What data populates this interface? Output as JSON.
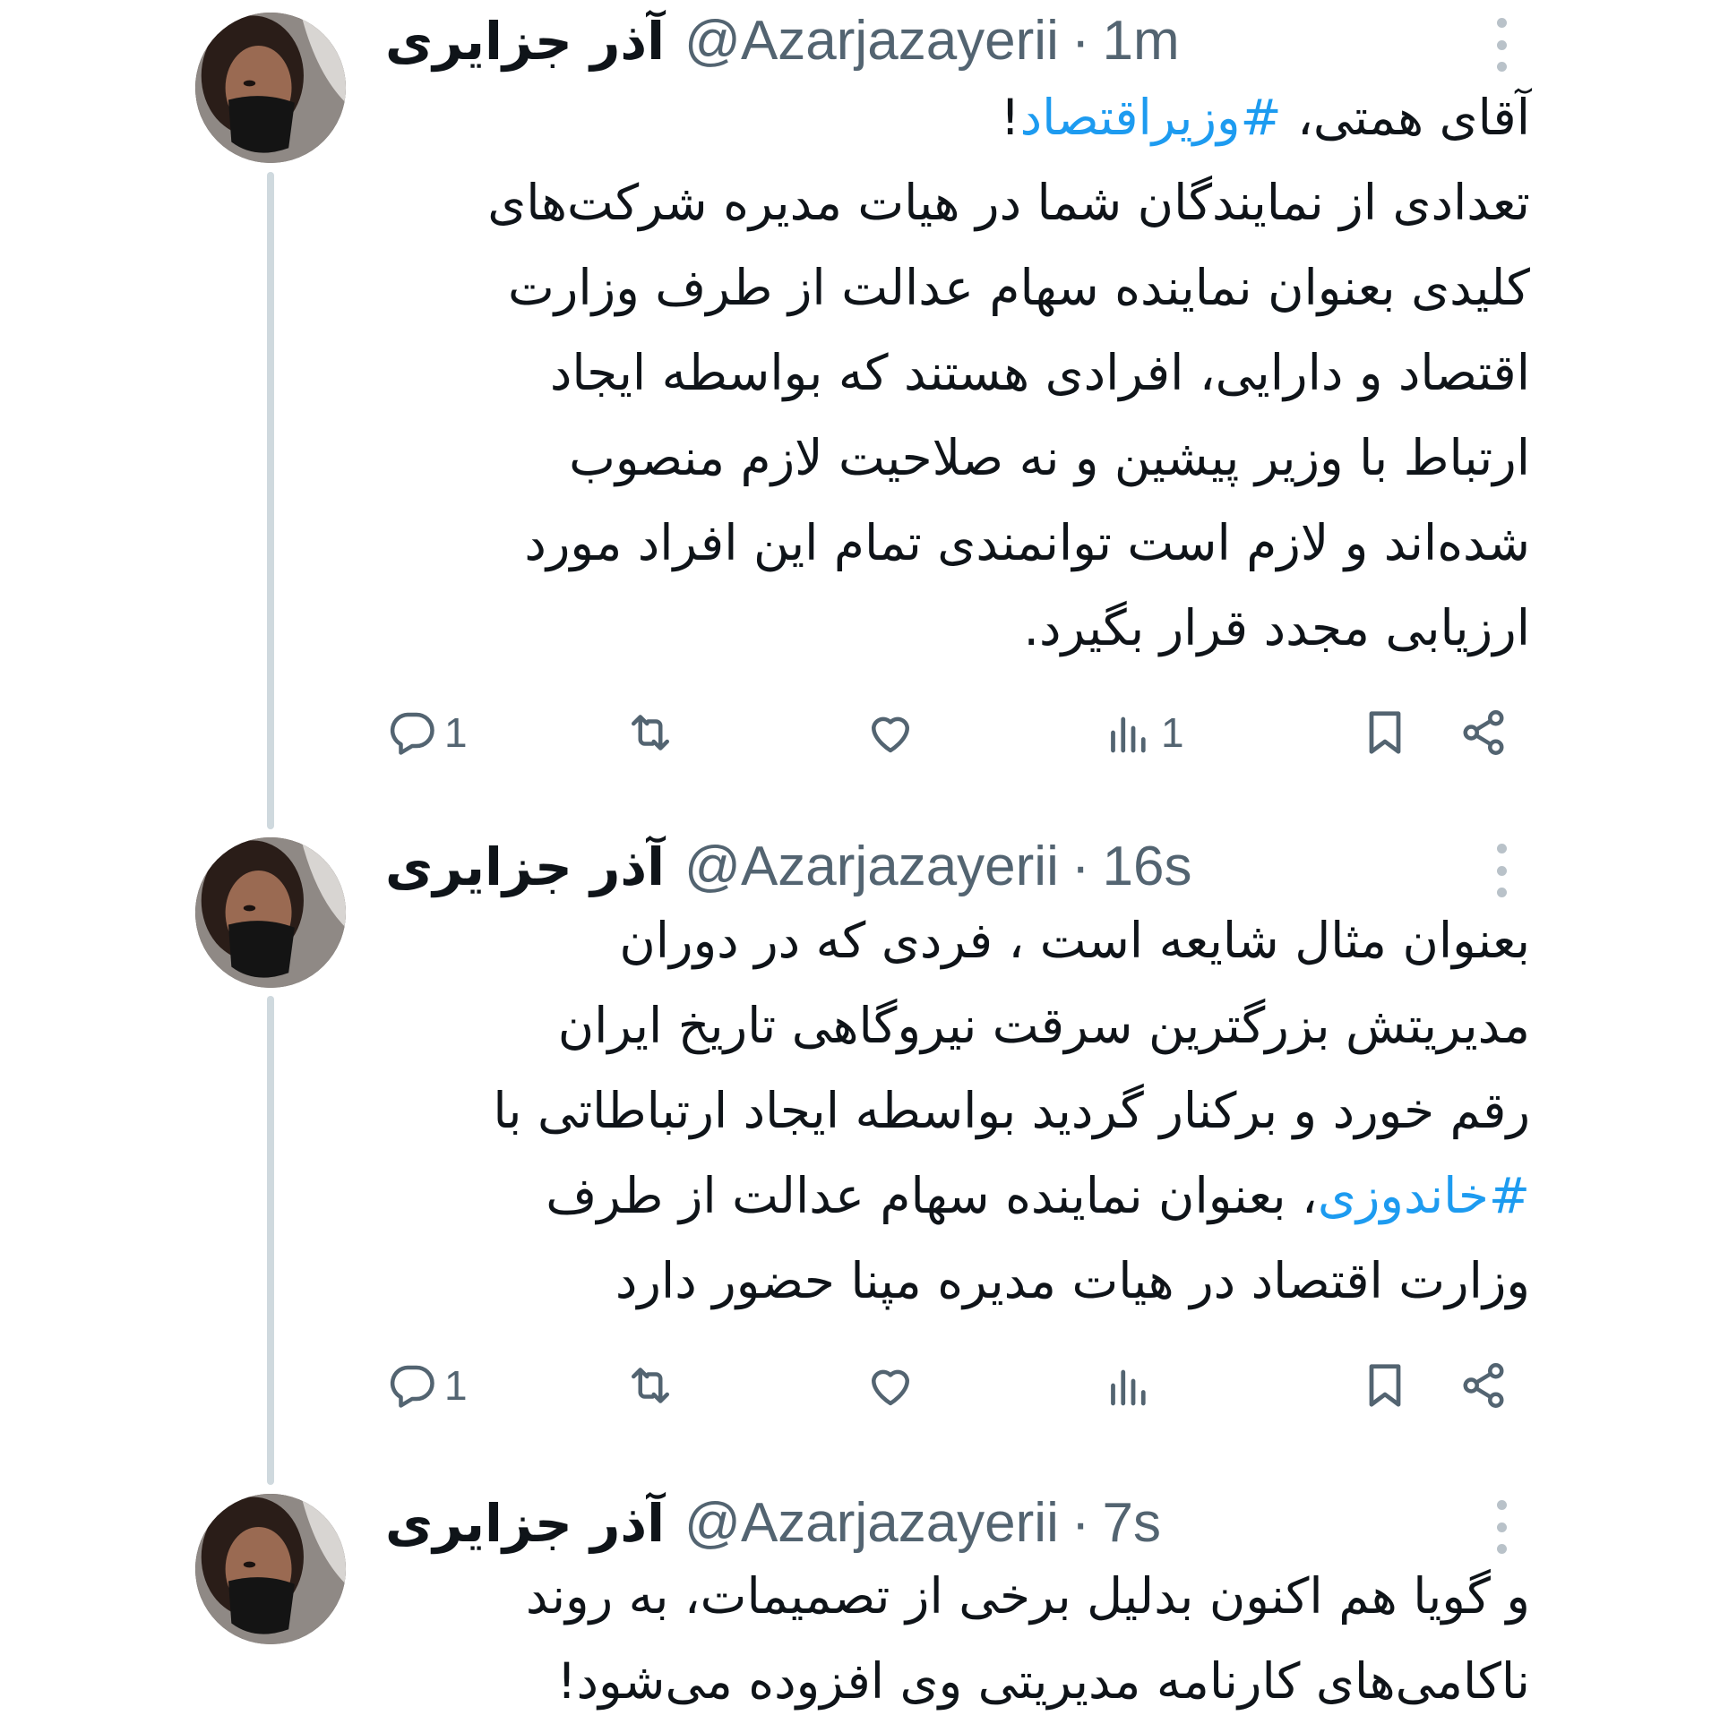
{
  "tweets": [
    {
      "display_name": "آذر جزایری",
      "handle": "@Azarjazayerii",
      "separator": "·",
      "time": "1m",
      "line1_prefix": "آقای همتی، ",
      "hashtag": "#وزیراقتصاد",
      "line1_suffix": "!",
      "lines": [
        "تعدادی از نمایندگان شما در هیات مدیره شرکت‌های",
        "کلیدی بعنوان نماینده سهام عدالت از طرف وزارت",
        "اقتصاد و دارایی، افرادی هستند که بواسطه ایجاد",
        "ارتباط با وزیر پیشین و نه صلاحیت لازم منصوب",
        "شده‌اند و لازم است توانمندی تمام این افراد مورد",
        "ارزیابی مجدد قرار بگیرد."
      ],
      "replies": "1",
      "views": "1",
      "icons": {
        "reply": "reply-icon",
        "retweet": "retweet-icon",
        "like": "like-icon",
        "views": "views-icon",
        "bookmark": "bookmark-icon",
        "share": "share-icon",
        "more": "more-icon"
      }
    },
    {
      "display_name": "آذر جزایری",
      "handle": "@Azarjazayerii",
      "separator": "·",
      "time": "16s",
      "lines": [
        "بعنوان مثال شایعه است ، فردی که در دوران",
        "مدیریتش بزرگترین سرقت نیروگاهی تاریخ ایران",
        "رقم خورد و برکنار گردید بواسطه ایجاد ارتباطاتی با"
      ],
      "hashtag": "#خاندوزی",
      "line4_suffix": "، بعنوان نماینده سهام عدالت از طرف",
      "line5": "وزارت اقتصاد در هیات مدیره مپنا حضور دارد",
      "replies": "1"
    },
    {
      "display_name": "آذر جزایری",
      "handle": "@Azarjazayerii",
      "separator": "·",
      "time": "7s",
      "lines": [
        "و گویا هم اکنون بدلیل برخی از تصمیمات، به روند",
        "ناکامی‌های کارنامه مدیریتی وی افزوده می‌شود!"
      ]
    }
  ],
  "colors": {
    "hashtag": "#1d9bf0",
    "secondary_text": "#536471",
    "thread_line": "#cfd9de"
  }
}
